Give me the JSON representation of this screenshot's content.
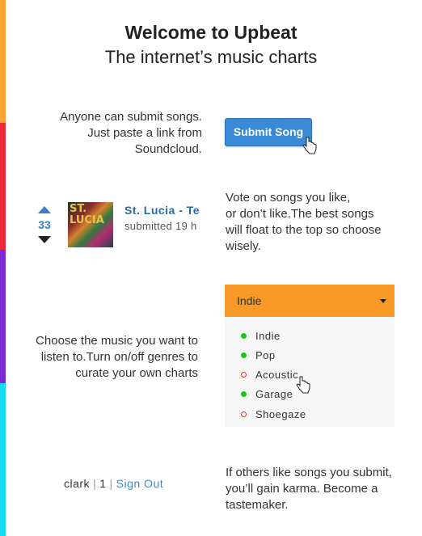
{
  "stripes": [
    "#f7a232",
    "#f0283a",
    "#7a2bd6",
    "#16d9f2"
  ],
  "header": {
    "title": "Welcome to Upbeat",
    "subtitle": "The internet’s music charts"
  },
  "submit_section": {
    "text_lines": [
      "Anyone can submit songs.",
      "Just paste a link from",
      "Soundcloud."
    ],
    "button_label": "Submit Song"
  },
  "vote_section": {
    "song": {
      "upvote_icon": "triangle-up-icon",
      "downvote_icon": "triangle-down-icon",
      "votes": "33",
      "title": "St. Lucia - Te",
      "meta": "submitted 19 h",
      "thumbnail_text": "ST. LUCIA"
    },
    "text_lines": [
      "Vote on songs you like,",
      "or don’t like.The best songs",
      "will float to the top so choose",
      "wisely."
    ]
  },
  "genre_section": {
    "text_lines": [
      "Choose the music you want to",
      "listen to.Turn on/off genres to",
      "curate your own charts"
    ],
    "dropdown_selected": "Indie",
    "genres": [
      {
        "label": "Indie",
        "on": true
      },
      {
        "label": "Pop",
        "on": true
      },
      {
        "label": "Acoustic",
        "on": false
      },
      {
        "label": "Garage",
        "on": true
      },
      {
        "label": "Shoegaze",
        "on": false
      }
    ]
  },
  "karma_section": {
    "user": {
      "name": "clark",
      "karma": "1",
      "signout_label": "Sign Out"
    },
    "text_lines": [
      "If others like songs you submit,",
      "you’ll gain karma. Become a",
      "tastemaker."
    ]
  },
  "colors": {
    "accent_blue": "#3a89d4",
    "dropdown_orange": "#f79a27",
    "genre_on": "#1ec21e",
    "genre_off": "#d23a2a"
  }
}
